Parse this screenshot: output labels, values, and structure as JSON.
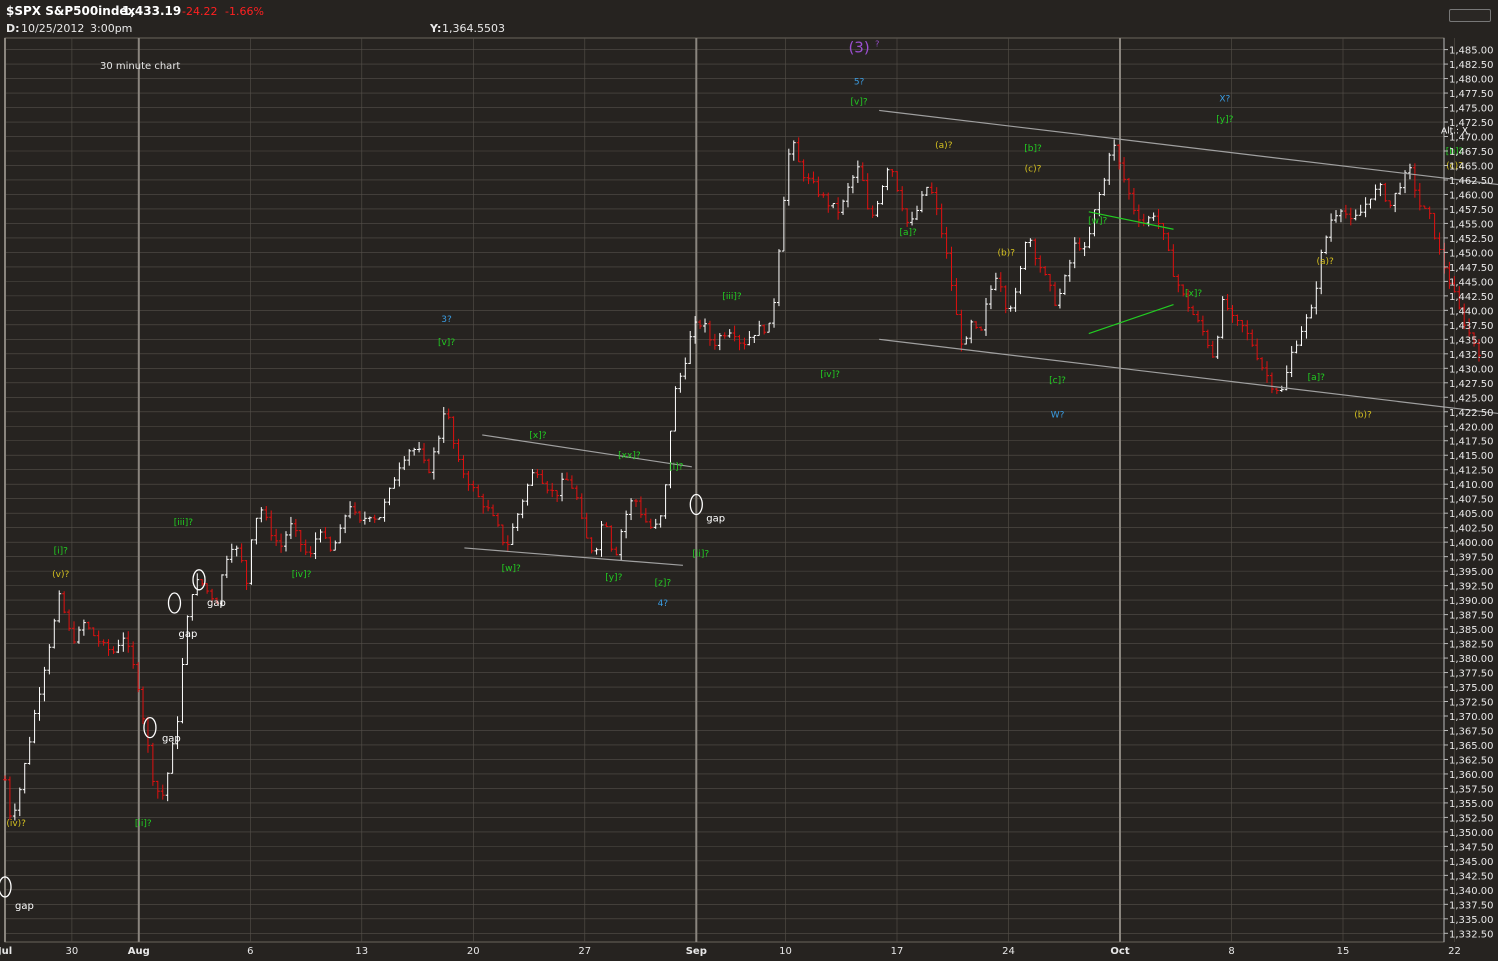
{
  "header": {
    "symbol": "$SPX S&P500index",
    "last_price": "1,433.19",
    "change": "-24.22",
    "change_pct": "-1.66%",
    "date_label": "D:",
    "date_value": "10/25/2012",
    "time_value": "3:00pm",
    "y_label": "Y:",
    "y_value": "1,364.5503"
  },
  "colors": {
    "background": "#262320",
    "grid": "#55504a",
    "up_bar": "#ffffff",
    "down_bar": "#e01010",
    "trendline": "#a0a0a0",
    "triangle": "#22cc22",
    "label_green": "#22cc22",
    "label_yellow": "#d4c020",
    "label_blue": "#3a9be0",
    "label_purple": "#9b4fd0",
    "change_red": "#ff2020"
  },
  "chart_data": {
    "type": "ohlc",
    "title": "30 minute chart",
    "ylim": [
      1331,
      1487
    ],
    "y_ticks": [
      "1,485.00",
      "1,482.50",
      "1,480.00",
      "1,477.50",
      "1,475.00",
      "1,472.50",
      "1,470.00",
      "1,467.50",
      "1,465.00",
      "1,462.50",
      "1,460.00",
      "1,457.50",
      "1,455.00",
      "1,452.50",
      "1,450.00",
      "1,447.50",
      "1,445.00",
      "1,442.50",
      "1,440.00",
      "1,437.50",
      "1,435.00",
      "1,432.50",
      "1,430.00",
      "1,427.50",
      "1,425.00",
      "1,422.50",
      "1,420.00",
      "1,417.50",
      "1,415.00",
      "1,412.50",
      "1,410.00",
      "1,407.50",
      "1,405.00",
      "1,402.50",
      "1,400.00",
      "1,397.50",
      "1,395.00",
      "1,392.50",
      "1,390.00",
      "1,387.50",
      "1,385.00",
      "1,382.50",
      "1,380.00",
      "1,377.50",
      "1,375.00",
      "1,372.50",
      "1,370.00",
      "1,367.50",
      "1,365.00",
      "1,362.50",
      "1,360.00",
      "1,357.50",
      "1,355.00",
      "1,352.50",
      "1,350.00",
      "1,347.50",
      "1,345.00",
      "1,342.50",
      "1,340.00",
      "1,337.50",
      "1,335.00",
      "1,332.50"
    ],
    "x_ticks": [
      {
        "t": 0,
        "label": "Jul",
        "month": true
      },
      {
        "t": 3,
        "label": "30",
        "month": false
      },
      {
        "t": 6,
        "label": "Aug",
        "month": true
      },
      {
        "t": 11,
        "label": "6",
        "month": false
      },
      {
        "t": 16,
        "label": "13",
        "month": false
      },
      {
        "t": 21,
        "label": "20",
        "month": false
      },
      {
        "t": 26,
        "label": "27",
        "month": false
      },
      {
        "t": 31,
        "label": "Sep",
        "month": true
      },
      {
        "t": 35,
        "label": "10",
        "month": false
      },
      {
        "t": 40,
        "label": "17",
        "month": false
      },
      {
        "t": 45,
        "label": "24",
        "month": false
      },
      {
        "t": 50,
        "label": "Oct",
        "month": true
      },
      {
        "t": 55,
        "label": "8",
        "month": false
      },
      {
        "t": 60,
        "label": "15",
        "month": false
      },
      {
        "t": 65,
        "label": "22",
        "month": false
      }
    ],
    "x_range": [
      0,
      68.5
    ],
    "path": [
      [
        0,
        1359
      ],
      [
        0.3,
        1352
      ],
      [
        0.8,
        1358
      ],
      [
        1.2,
        1365
      ],
      [
        1.6,
        1372
      ],
      [
        2.1,
        1380
      ],
      [
        2.5,
        1386
      ],
      [
        2.8,
        1391
      ],
      [
        3.2,
        1385
      ],
      [
        3.6,
        1383
      ],
      [
        4.0,
        1386
      ],
      [
        4.5,
        1384
      ],
      [
        5.0,
        1382
      ],
      [
        5.5,
        1381
      ],
      [
        6.0,
        1384
      ],
      [
        6.4,
        1380
      ],
      [
        6.8,
        1375
      ],
      [
        7.2,
        1366
      ],
      [
        7.6,
        1358
      ],
      [
        8.0,
        1356
      ],
      [
        8.4,
        1362
      ],
      [
        8.8,
        1370
      ],
      [
        9.2,
        1385
      ],
      [
        9.6,
        1393
      ],
      [
        10.0,
        1393
      ],
      [
        10.4,
        1391
      ],
      [
        10.8,
        1390
      ],
      [
        11.2,
        1397
      ],
      [
        11.6,
        1400
      ],
      [
        12.0,
        1397
      ],
      [
        12.3,
        1393
      ],
      [
        12.6,
        1403
      ],
      [
        13.0,
        1406
      ],
      [
        13.5,
        1402
      ],
      [
        14.0,
        1399
      ],
      [
        14.5,
        1403
      ],
      [
        15.0,
        1400
      ],
      [
        15.5,
        1397
      ],
      [
        16.0,
        1403
      ],
      [
        16.5,
        1398
      ],
      [
        17.0,
        1401
      ],
      [
        17.5,
        1407
      ],
      [
        18.0,
        1403
      ],
      [
        18.5,
        1405
      ],
      [
        19.0,
        1404
      ],
      [
        19.5,
        1408
      ],
      [
        20.0,
        1413
      ],
      [
        20.5,
        1416
      ],
      [
        21.0,
        1416
      ],
      [
        21.5,
        1412
      ],
      [
        22.0,
        1417
      ],
      [
        22.4,
        1424
      ],
      [
        22.7,
        1419
      ],
      [
        23.0,
        1414
      ],
      [
        23.5,
        1411
      ],
      [
        24.0,
        1408
      ],
      [
        24.5,
        1406
      ],
      [
        25.0,
        1403
      ],
      [
        25.5,
        1399
      ],
      [
        26.0,
        1404
      ],
      [
        26.5,
        1409
      ],
      [
        27.0,
        1413
      ],
      [
        27.5,
        1410
      ],
      [
        28.0,
        1408
      ],
      [
        28.5,
        1411
      ],
      [
        29.0,
        1409
      ],
      [
        29.5,
        1401
      ],
      [
        30.0,
        1398
      ],
      [
        30.5,
        1405
      ],
      [
        31.0,
        1397
      ],
      [
        31.5,
        1404
      ],
      [
        32.0,
        1408
      ],
      [
        32.5,
        1404
      ],
      [
        33.0,
        1402
      ],
      [
        33.5,
        1405
      ],
      [
        34.0,
        1425
      ],
      [
        34.5,
        1430
      ],
      [
        35.0,
        1437
      ],
      [
        35.5,
        1438
      ],
      [
        36.0,
        1434
      ],
      [
        36.5,
        1436
      ],
      [
        37.0,
        1437
      ],
      [
        37.5,
        1434
      ],
      [
        38.0,
        1436
      ],
      [
        38.5,
        1437
      ],
      [
        39.0,
        1437
      ],
      [
        39.3,
        1448
      ],
      [
        39.7,
        1462
      ],
      [
        40.0,
        1470
      ],
      [
        40.3,
        1466
      ],
      [
        40.7,
        1463
      ],
      [
        41.0,
        1462
      ],
      [
        41.5,
        1460
      ],
      [
        42.0,
        1458
      ],
      [
        42.5,
        1457
      ],
      [
        43.0,
        1462
      ],
      [
        43.5,
        1465
      ],
      [
        44.0,
        1455
      ],
      [
        44.5,
        1460
      ],
      [
        45.0,
        1466
      ],
      [
        45.5,
        1460
      ],
      [
        46.0,
        1454
      ],
      [
        46.5,
        1458
      ],
      [
        47.0,
        1462
      ],
      [
        47.5,
        1456
      ],
      [
        48.0,
        1448
      ],
      [
        48.5,
        1437
      ],
      [
        48.8,
        1433
      ],
      [
        49.2,
        1438
      ],
      [
        49.6,
        1435
      ],
      [
        50.0,
        1442
      ],
      [
        50.5,
        1447
      ],
      [
        51.0,
        1440
      ],
      [
        51.5,
        1443
      ],
      [
        52.0,
        1454
      ],
      [
        52.5,
        1449
      ],
      [
        53.0,
        1445
      ],
      [
        53.5,
        1441
      ],
      [
        54.0,
        1446
      ],
      [
        54.5,
        1452
      ],
      [
        55.0,
        1450
      ],
      [
        55.5,
        1458
      ],
      [
        56.0,
        1463
      ],
      [
        56.3,
        1470
      ],
      [
        56.6,
        1466
      ],
      [
        57.0,
        1462
      ],
      [
        57.5,
        1457
      ],
      [
        58.0,
        1455
      ],
      [
        58.5,
        1457
      ],
      [
        59.0,
        1452
      ],
      [
        59.5,
        1446
      ],
      [
        60.0,
        1442
      ],
      [
        60.5,
        1439
      ],
      [
        61.0,
        1436
      ],
      [
        61.5,
        1432
      ],
      [
        62.0,
        1442
      ],
      [
        62.5,
        1438
      ],
      [
        63.0,
        1437
      ],
      [
        63.5,
        1434
      ],
      [
        64.0,
        1430
      ],
      [
        64.5,
        1427
      ],
      [
        65.0,
        1426
      ],
      [
        65.5,
        1433
      ],
      [
        66.0,
        1437
      ],
      [
        66.5,
        1440
      ],
      [
        67.0,
        1450
      ],
      [
        67.5,
        1456
      ],
      [
        68.0,
        1458
      ],
      [
        68.5,
        1455
      ],
      [
        69.0,
        1457
      ],
      [
        69.5,
        1460
      ],
      [
        70.0,
        1461
      ],
      [
        70.5,
        1458
      ],
      [
        71.0,
        1462
      ],
      [
        71.5,
        1464
      ],
      [
        72.0,
        1458
      ],
      [
        72.5,
        1456
      ],
      [
        73.0,
        1450
      ],
      [
        73.5,
        1445
      ],
      [
        74.0,
        1440
      ],
      [
        74.5,
        1436
      ],
      [
        75.0,
        1433
      ]
    ],
    "path_x_scale": 0.8813,
    "trendlines": [
      {
        "kind": "channel",
        "from": [
          39.2,
          1474.5
        ],
        "to": [
          68.5,
          1461
        ]
      },
      {
        "kind": "channel",
        "from": [
          39.2,
          1435
        ],
        "to": [
          68.5,
          1421.5
        ]
      },
      {
        "kind": "flat",
        "from": [
          21.4,
          1418.5
        ],
        "to": [
          30.8,
          1413
        ]
      },
      {
        "kind": "flat",
        "from": [
          20.6,
          1399
        ],
        "to": [
          30.4,
          1396
        ]
      },
      {
        "kind": "triangle",
        "from": [
          48.6,
          1457
        ],
        "to": [
          52.4,
          1454
        ]
      },
      {
        "kind": "triangle",
        "from": [
          48.6,
          1436
        ],
        "to": [
          52.4,
          1441
        ]
      }
    ],
    "gap_markers": [
      {
        "t": 0.0,
        "v": 1340.5,
        "label": "gap",
        "label_dx": 10,
        "label_dy": 22
      },
      {
        "t": 6.5,
        "v": 1368,
        "label": "gap",
        "label_dx": 12,
        "label_dy": 14
      },
      {
        "t": 7.6,
        "v": 1389.5,
        "label": "gap",
        "label_dx": 4,
        "label_dy": 34
      },
      {
        "t": 8.7,
        "v": 1393.5,
        "label": "gap",
        "label_dx": 8,
        "label_dy": 26
      },
      {
        "t": 31.0,
        "v": 1406.5,
        "label": "gap",
        "label_dx": 10,
        "label_dy": 17
      }
    ],
    "wave_labels": [
      {
        "t": 0.5,
        "v": 1351,
        "text": "(iv)?",
        "color": "yellow"
      },
      {
        "t": 2.5,
        "v": 1398,
        "text": "[i]?",
        "color": "green"
      },
      {
        "t": 2.5,
        "v": 1394,
        "text": "(v)?",
        "color": "yellow"
      },
      {
        "t": 6.2,
        "v": 1351,
        "text": "[ii]?",
        "color": "green"
      },
      {
        "t": 8.0,
        "v": 1403,
        "text": "[iii]?",
        "color": "green"
      },
      {
        "t": 13.3,
        "v": 1394,
        "text": "[iv]?",
        "color": "green"
      },
      {
        "t": 19.8,
        "v": 1438,
        "text": "3?",
        "color": "blue"
      },
      {
        "t": 19.8,
        "v": 1434,
        "text": "[v]?",
        "color": "green"
      },
      {
        "t": 23.9,
        "v": 1418,
        "text": "[x]?",
        "color": "green"
      },
      {
        "t": 22.7,
        "v": 1395,
        "text": "[w]?",
        "color": "green"
      },
      {
        "t": 28.0,
        "v": 1414.5,
        "text": "[xx]?",
        "color": "green"
      },
      {
        "t": 27.3,
        "v": 1393.5,
        "text": "[y]?",
        "color": "green"
      },
      {
        "t": 30.1,
        "v": 1412.5,
        "text": "[i]?",
        "color": "green"
      },
      {
        "t": 29.5,
        "v": 1392.5,
        "text": "[z]?",
        "color": "green"
      },
      {
        "t": 29.5,
        "v": 1389,
        "text": "4?",
        "color": "blue"
      },
      {
        "t": 31.2,
        "v": 1397.5,
        "text": "[ii]?",
        "color": "green"
      },
      {
        "t": 32.6,
        "v": 1442,
        "text": "[iii]?",
        "color": "green"
      },
      {
        "t": 37.0,
        "v": 1428.5,
        "text": "[iv]?",
        "color": "green"
      },
      {
        "t": 38.3,
        "v": 1484.5,
        "text": "(3)",
        "color": "purple",
        "big": true
      },
      {
        "t": 38.3,
        "v": 1479,
        "text": "5?",
        "color": "blue"
      },
      {
        "t": 38.3,
        "v": 1475.5,
        "text": "[v]?",
        "color": "green"
      },
      {
        "t": 40.5,
        "v": 1453,
        "text": "[a]?",
        "color": "green"
      },
      {
        "t": 42.1,
        "v": 1468,
        "text": "(a)?",
        "color": "yellow"
      },
      {
        "t": 44.9,
        "v": 1449.5,
        "text": "(b)?",
        "color": "yellow"
      },
      {
        "t": 46.1,
        "v": 1467.5,
        "text": "[b]?",
        "color": "green"
      },
      {
        "t": 46.1,
        "v": 1464,
        "text": "(c)?",
        "color": "yellow"
      },
      {
        "t": 47.2,
        "v": 1427.5,
        "text": "[c]?",
        "color": "green"
      },
      {
        "t": 47.2,
        "v": 1421.5,
        "text": "W?",
        "color": "blue"
      },
      {
        "t": 49.0,
        "v": 1455,
        "text": "[w]?",
        "color": "green"
      },
      {
        "t": 53.3,
        "v": 1442.5,
        "text": "[x]?",
        "color": "green"
      },
      {
        "t": 54.7,
        "v": 1476,
        "text": "X?",
        "color": "blue"
      },
      {
        "t": 54.7,
        "v": 1472.5,
        "text": "[y]?",
        "color": "green"
      },
      {
        "t": 59.2,
        "v": 1448,
        "text": "(a)?",
        "color": "yellow"
      },
      {
        "t": 58.8,
        "v": 1428,
        "text": "[a]?",
        "color": "green"
      },
      {
        "t": 60.9,
        "v": 1421.5,
        "text": "(b)?",
        "color": "yellow"
      },
      {
        "t": 65.0,
        "v": 1470.5,
        "text": "Alt.: X",
        "color": "white"
      },
      {
        "t": 65.0,
        "v": 1467,
        "text": "[b]?",
        "color": "green"
      },
      {
        "t": 65.0,
        "v": 1464.5,
        "text": "(c)?",
        "color": "yellow"
      }
    ]
  }
}
